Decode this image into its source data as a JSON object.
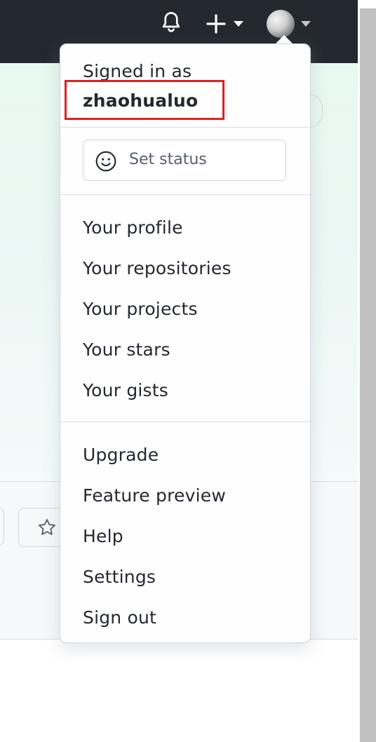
{
  "colors": {
    "header_bg": "#24292f",
    "highlight_border": "#e02020",
    "menu_bg": "#fffefe",
    "text": "#24292f"
  },
  "header": {
    "icons": [
      "bell-icon",
      "plus-icon",
      "chevron-down-icon",
      "avatar",
      "chevron-down-icon"
    ]
  },
  "user_menu": {
    "signed_in_label": "Signed in as",
    "username": "zhaohualuo",
    "set_status_label": "Set status",
    "set_status_icon": "smiley-icon",
    "profile_items": [
      "Your profile",
      "Your repositories",
      "Your projects",
      "Your stars",
      "Your gists"
    ],
    "account_items": [
      "Upgrade",
      "Feature preview",
      "Help",
      "Settings",
      "Sign out"
    ]
  },
  "background": {
    "icons": [
      "star-icon"
    ]
  }
}
